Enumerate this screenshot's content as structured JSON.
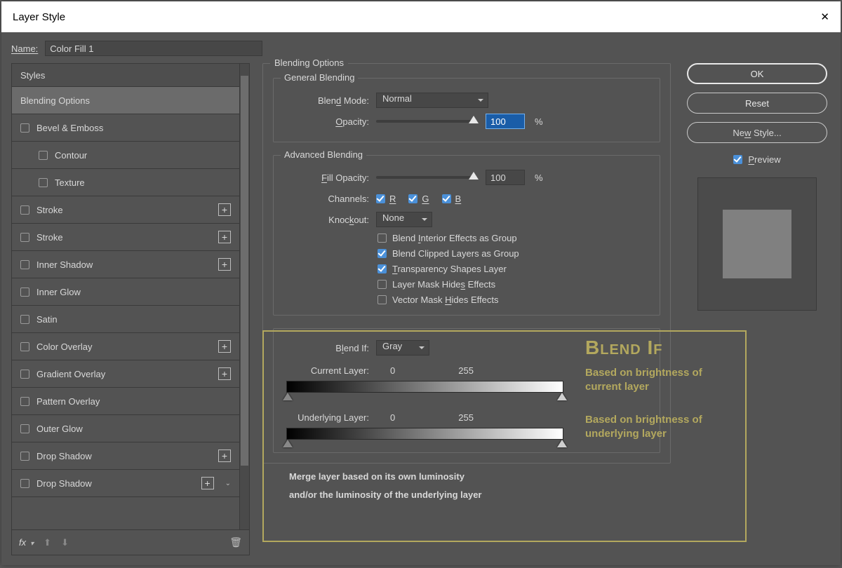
{
  "dialog": {
    "title": "Layer Style"
  },
  "name": {
    "label": "Name:",
    "value": "Color Fill 1"
  },
  "styles": {
    "header": "Styles",
    "items": [
      {
        "label": "Blending Options",
        "active": true,
        "checkbox": null
      },
      {
        "label": "Bevel & Emboss",
        "checkbox": false
      },
      {
        "label": "Contour",
        "sub": true,
        "checkbox": false
      },
      {
        "label": "Texture",
        "sub": true,
        "checkbox": false
      },
      {
        "label": "Stroke",
        "checkbox": false,
        "plus": true
      },
      {
        "label": "Stroke",
        "checkbox": false,
        "plus": true
      },
      {
        "label": "Inner Shadow",
        "checkbox": false,
        "plus": true
      },
      {
        "label": "Inner Glow",
        "checkbox": false
      },
      {
        "label": "Satin",
        "checkbox": false
      },
      {
        "label": "Color Overlay",
        "checkbox": false,
        "plus": true
      },
      {
        "label": "Gradient Overlay",
        "checkbox": false,
        "plus": true
      },
      {
        "label": "Pattern Overlay",
        "checkbox": false
      },
      {
        "label": "Outer Glow",
        "checkbox": false
      },
      {
        "label": "Drop Shadow",
        "checkbox": false,
        "plus": true
      },
      {
        "label": "Drop Shadow",
        "checkbox": false,
        "plus": true
      }
    ]
  },
  "footer": {
    "fx": "fx"
  },
  "blending": {
    "title": "Blending Options",
    "general": {
      "title": "General Blending",
      "blend_mode_label": "Blend Mode:",
      "blend_mode_value": "Normal",
      "opacity_label": "Opacity:",
      "opacity_value": "100",
      "opacity_unit": "%"
    },
    "advanced": {
      "title": "Advanced Blending",
      "fill_opacity_label": "Fill Opacity:",
      "fill_opacity_value": "100",
      "fill_opacity_unit": "%",
      "channels_label": "Channels:",
      "chan_r": "R",
      "chan_g": "G",
      "chan_b": "B",
      "knockout_label": "Knockout:",
      "knockout_value": "None",
      "opts": {
        "interior": {
          "checked": false,
          "label_pre": "Blend ",
          "u": "I",
          "label_post": "nterior Effects as Group"
        },
        "clipped": {
          "checked": true,
          "label": "Blend Clipped Layers as Group"
        },
        "transparency": {
          "checked": true,
          "u": "T",
          "label_post": "ransparency Shapes Layer"
        },
        "layermask": {
          "checked": false,
          "label_pre": "Layer Mask Hide",
          "u": "s",
          "label_post": " Effects"
        },
        "vectormask": {
          "checked": false,
          "label_pre": "Vector Mask ",
          "u": "H",
          "label_post": "ides Effects"
        }
      }
    },
    "blendif": {
      "label": "Blend If:",
      "channel": "Gray",
      "current_label": "Current Layer:",
      "current_lo": "0",
      "current_hi": "255",
      "underlying_label": "Underlying Layer:",
      "under_lo": "0",
      "under_hi": "255"
    }
  },
  "buttons": {
    "ok": "OK",
    "reset": "Reset",
    "new_style": "New Style...",
    "preview": "Preview"
  },
  "annotation": {
    "title": "Blend If",
    "line1": "Based on brightness of current layer",
    "line2": "Based on brightness of underlying layer",
    "line3a": "Merge layer based on its own luminosity",
    "line3b": "and/or the luminosity of the underlying layer"
  }
}
